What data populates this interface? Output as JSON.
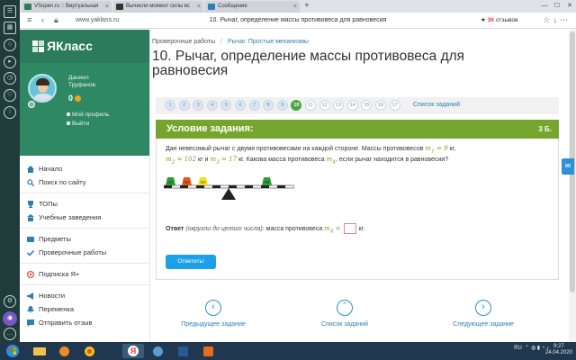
{
  "browser": {
    "tabs": [
      {
        "label": "VSopen.ru :: Виртуальная",
        "color": "#2c7b5c"
      },
      {
        "label": "Вычисли момент силы вс",
        "color": "#333333"
      },
      {
        "label": "Сообщение",
        "color": "#2b7fb5"
      }
    ],
    "url": "www.yaklass.ru",
    "page_title": "10. Рычаг, определение массы противовеса для равновесия",
    "badge_prefix": "★",
    "badge_count": "3К",
    "badge_label": "отзывов"
  },
  "sidebar": {
    "brand": "ЯКласс",
    "user_first": "Даниил",
    "user_last": "Труфанов",
    "points": "0",
    "profile_link": "Мой профиль",
    "logout_link": "Выйти",
    "menu_group1": [
      "Начало",
      "Поиск по сайту"
    ],
    "menu_group2": [
      "ТОПы",
      "Учебные заведения"
    ],
    "menu_group3": [
      "Предметы",
      "Проверочные работы"
    ],
    "menu_group4": [
      "Подписка Я+"
    ],
    "menu_group5": [
      "Новости",
      "Переменка",
      "Отправить отзыв"
    ]
  },
  "main": {
    "crumb_1": "Проверочные работы",
    "crumb_sep": "/",
    "crumb_2": "Рычаг. Простые механизмы",
    "title": "10. Рычаг, определение массы противовеса для равновесия",
    "pages": [
      "1",
      "2",
      "3",
      "4",
      "5",
      "6",
      "7",
      "8",
      "9",
      "10",
      "11",
      "12",
      "13",
      "14",
      "15",
      "16",
      "17"
    ],
    "done_pages": [
      1,
      2,
      3,
      4,
      5,
      6,
      7,
      8,
      9
    ],
    "active_page": 10,
    "task_list": "Список заданий",
    "task_header": "Условие задания:",
    "task_points": "3 Б.",
    "text_1": "Дан невесомый рычаг с двумя противовесами на каждой стороне. Массы противовесов",
    "m1": "m",
    "m1_sub": "1",
    "m1_val": "= 9",
    "unit_kg": "кг,",
    "m2": "m",
    "m2_sub": "2",
    "m2_val": "= 102",
    "and_word": "кг и",
    "m3": "m",
    "m3_sub": "3",
    "m3_val": "= 17",
    "text_2": "кг. Какова масса противовеса",
    "m4": "m",
    "m4_sub": "4",
    "text_3": ", если рычаг находится в равновесии?",
    "answer_label": "Ответ",
    "answer_hint": "(округли до целого числа)",
    "answer_text": ": масса противовеса",
    "answer_eq": "=",
    "answer_unit": "кг.",
    "submit": "Ответить!",
    "prev": "Предыдущее задание",
    "list": "Список заданий",
    "next": "Следующее задание",
    "weights": [
      "m1",
      "m2",
      "m3",
      "m4"
    ]
  },
  "taskbar": {
    "lang": "RU",
    "time": "9:27",
    "date": "24.04.2020"
  }
}
